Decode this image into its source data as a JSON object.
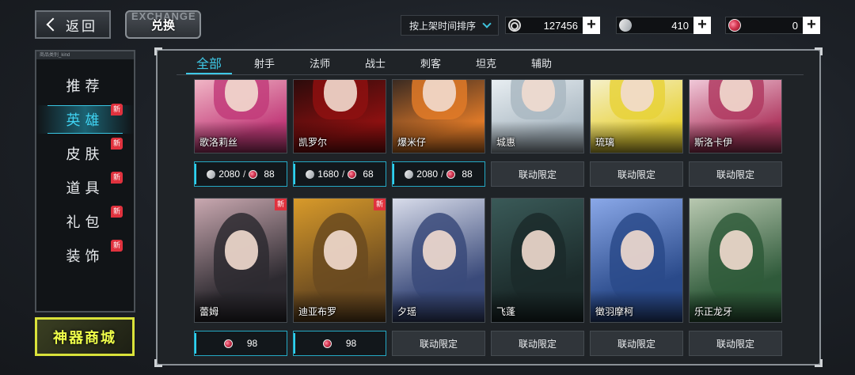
{
  "top_bar": {
    "back_label": "返回",
    "exchange_bg_word": "EXCHANGE",
    "exchange_label": "兑换",
    "sort_label": "按上架时间排序",
    "currencies": [
      {
        "icon": "coin-icon",
        "value": "127456"
      },
      {
        "icon": "diamond-icon",
        "value": "410"
      },
      {
        "icon": "gem-icon",
        "value": "0"
      }
    ]
  },
  "sidebar": {
    "header": "商品类别_kind",
    "new_label": "新",
    "items": [
      {
        "label": "推荐",
        "new": false,
        "active": false
      },
      {
        "label": "英雄",
        "new": true,
        "active": true
      },
      {
        "label": "皮肤",
        "new": true,
        "active": false
      },
      {
        "label": "道具",
        "new": true,
        "active": false
      },
      {
        "label": "礼包",
        "new": true,
        "active": false
      },
      {
        "label": "装饰",
        "new": true,
        "active": false
      }
    ],
    "artifact_label": "神器商城"
  },
  "tabs": [
    "全部",
    "射手",
    "法师",
    "战士",
    "刺客",
    "坦克",
    "辅助"
  ],
  "heroes_row1": [
    {
      "name": "歌洛莉丝",
      "price": {
        "diamond": "2080",
        "gem": "88"
      },
      "colors": [
        "#c23c7a",
        "#f0b5c5"
      ]
    },
    {
      "name": "凯罗尔",
      "price": {
        "diamond": "1680",
        "gem": "68"
      },
      "colors": [
        "#8e1010",
        "#2b0b0b"
      ]
    },
    {
      "name": "爆米仔",
      "price": {
        "diamond": "2080",
        "gem": "88"
      },
      "colors": [
        "#e07a28",
        "#3a2a22"
      ]
    },
    {
      "name": "城惠",
      "price": null,
      "locked_label": "联动限定",
      "colors": [
        "#aab8c2",
        "#e8eef2"
      ]
    },
    {
      "name": "琉璃",
      "price": null,
      "locked_label": "联动限定",
      "colors": [
        "#e8d23a",
        "#f5f0c8"
      ]
    },
    {
      "name": "斯洛卡伊",
      "price": null,
      "locked_label": "联动限定",
      "colors": [
        "#b03b62",
        "#f0c8d8"
      ]
    }
  ],
  "heroes_row2": [
    {
      "name": "蕾姆",
      "new": true,
      "price": {
        "gem": "98"
      },
      "colors": [
        "#2d2a30",
        "#c9a8b0"
      ]
    },
    {
      "name": "迪亚布罗",
      "new": true,
      "price": {
        "gem": "98"
      },
      "colors": [
        "#6a4a20",
        "#d89a2a"
      ]
    },
    {
      "name": "夕瑶",
      "new": false,
      "price": null,
      "locked_label": "联动限定",
      "colors": [
        "#3a4a7a",
        "#d8dcea"
      ]
    },
    {
      "name": "飞蓬",
      "new": false,
      "price": null,
      "locked_label": "联动限定",
      "colors": [
        "#1b2a2a",
        "#3a5a58"
      ]
    },
    {
      "name": "徵羽摩柯",
      "new": false,
      "price": null,
      "locked_label": "联动限定",
      "colors": [
        "#2a4a8a",
        "#8aa8e8"
      ]
    },
    {
      "name": "乐正龙牙",
      "new": false,
      "price": null,
      "locked_label": "联动限定",
      "colors": [
        "#2f5a3a",
        "#b8c8b0"
      ]
    }
  ]
}
